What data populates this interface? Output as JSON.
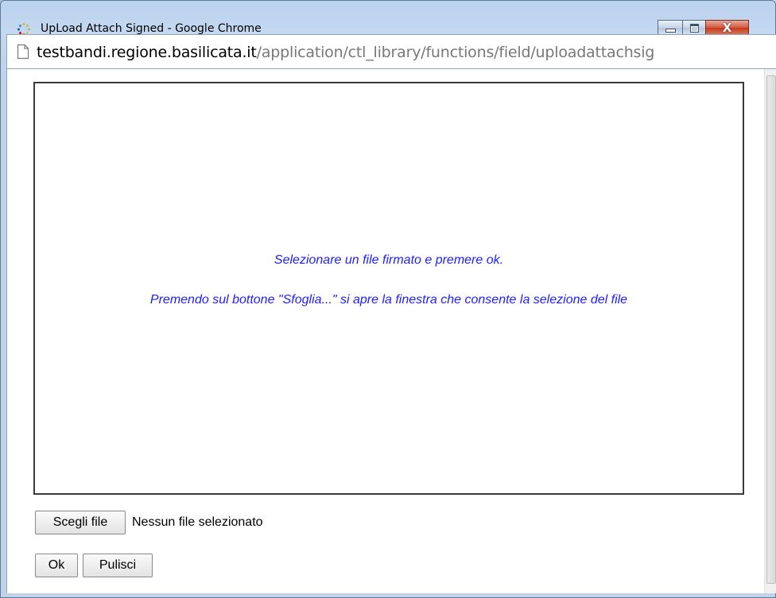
{
  "window": {
    "title": "UpLoad Attach Signed - Google Chrome",
    "controls": {
      "minimize": "minimize",
      "maximize": "maximize",
      "close": "X"
    }
  },
  "address_bar": {
    "host": "testbandi.regione.basilicata.it",
    "path": "/application/ctl_library/functions/field/uploadattachsig"
  },
  "panel": {
    "line1": "Selezionare un file firmato e premere ok.",
    "line2": "Premendo sul bottone \"Sfoglia...\" si apre la finestra che consente la selezione del file"
  },
  "file_input": {
    "button_label": "Scegli file",
    "status": "Nessun file selezionato"
  },
  "actions": {
    "ok_label": "Ok",
    "clear_label": "Pulisci"
  },
  "colors": {
    "message_text": "#2020ff",
    "window_frame": "#bfd3ea",
    "close_button": "#c5391c"
  },
  "icons": [
    "app-icon",
    "minimize-icon",
    "maximize-icon",
    "close-icon",
    "page-icon"
  ]
}
